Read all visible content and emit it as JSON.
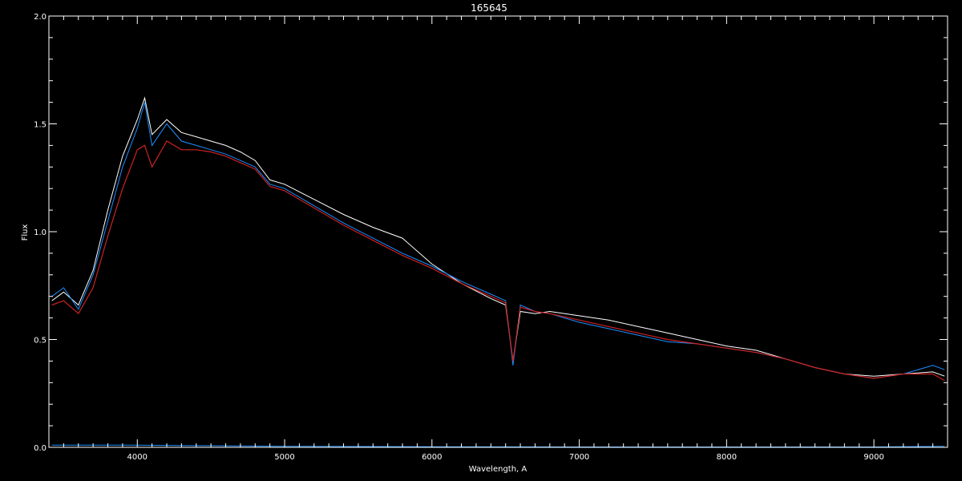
{
  "chart_data": {
    "type": "line",
    "title": "165645",
    "xlabel": "Wavelength, A",
    "ylabel": "Flux",
    "xlim": [
      3400,
      9500
    ],
    "ylim": [
      0.0,
      2.0
    ],
    "xticks": [
      4000,
      5000,
      6000,
      7000,
      8000,
      9000
    ],
    "yticks": [
      0.0,
      0.5,
      1.0,
      1.5,
      2.0
    ],
    "ytick_labels": [
      "0.0",
      "0.5",
      "1.0",
      "1.5",
      "2.0"
    ],
    "background": "#000000",
    "axis_color": "#ffffff",
    "grid": false,
    "legend": "none",
    "series": [
      {
        "color": "#ffffff",
        "x": [
          3420,
          3500,
          3600,
          3700,
          3800,
          3900,
          4000,
          4050,
          4100,
          4200,
          4300,
          4400,
          4500,
          4600,
          4700,
          4800,
          4900,
          5000,
          5200,
          5400,
          5600,
          5800,
          6000,
          6200,
          6400,
          6500,
          6550,
          6600,
          6700,
          6800,
          7000,
          7200,
          7400,
          7600,
          7800,
          8000,
          8200,
          8400,
          8600,
          8800,
          9000,
          9200,
          9400,
          9480
        ],
        "y": [
          0.68,
          0.72,
          0.66,
          0.82,
          1.1,
          1.35,
          1.52,
          1.62,
          1.45,
          1.52,
          1.46,
          1.44,
          1.42,
          1.4,
          1.37,
          1.33,
          1.24,
          1.22,
          1.15,
          1.08,
          1.02,
          0.97,
          0.85,
          0.76,
          0.69,
          0.66,
          0.4,
          0.63,
          0.62,
          0.63,
          0.61,
          0.59,
          0.56,
          0.53,
          0.5,
          0.47,
          0.45,
          0.41,
          0.37,
          0.34,
          0.33,
          0.34,
          0.35,
          0.33
        ]
      },
      {
        "color": "#1e90ff",
        "x": [
          3420,
          3500,
          3600,
          3700,
          3800,
          3900,
          4000,
          4050,
          4100,
          4200,
          4300,
          4400,
          4500,
          4600,
          4700,
          4800,
          4900,
          5000,
          5200,
          5400,
          5600,
          5800,
          6000,
          6200,
          6400,
          6500,
          6550,
          6600,
          6700,
          6800,
          7000,
          7200,
          7400,
          7600,
          7800,
          8000,
          8200,
          8400,
          8600,
          8800,
          9000,
          9200,
          9400,
          9480
        ],
        "y": [
          0.7,
          0.74,
          0.64,
          0.8,
          1.05,
          1.3,
          1.48,
          1.6,
          1.4,
          1.5,
          1.42,
          1.4,
          1.38,
          1.36,
          1.33,
          1.3,
          1.22,
          1.2,
          1.12,
          1.04,
          0.97,
          0.9,
          0.84,
          0.77,
          0.71,
          0.68,
          0.38,
          0.66,
          0.63,
          0.62,
          0.58,
          0.55,
          0.52,
          0.49,
          0.48,
          0.46,
          0.44,
          0.41,
          0.37,
          0.34,
          0.32,
          0.34,
          0.38,
          0.36
        ]
      },
      {
        "color": "#cc2222",
        "x": [
          3420,
          3500,
          3600,
          3700,
          3800,
          3900,
          4000,
          4050,
          4100,
          4200,
          4300,
          4400,
          4500,
          4600,
          4700,
          4800,
          4900,
          5000,
          5200,
          5400,
          5600,
          5800,
          6000,
          6200,
          6400,
          6500,
          6550,
          6600,
          6700,
          6800,
          7000,
          7200,
          7400,
          7600,
          7800,
          8000,
          8200,
          8400,
          8600,
          8800,
          9000,
          9200,
          9400,
          9480
        ],
        "y": [
          0.66,
          0.68,
          0.62,
          0.74,
          0.98,
          1.2,
          1.38,
          1.4,
          1.3,
          1.42,
          1.38,
          1.38,
          1.37,
          1.35,
          1.32,
          1.29,
          1.21,
          1.19,
          1.11,
          1.03,
          0.96,
          0.89,
          0.83,
          0.76,
          0.7,
          0.67,
          0.4,
          0.65,
          0.63,
          0.62,
          0.59,
          0.56,
          0.53,
          0.5,
          0.48,
          0.46,
          0.44,
          0.41,
          0.37,
          0.34,
          0.32,
          0.34,
          0.34,
          0.31
        ]
      },
      {
        "color": "#1e90ff",
        "x": [
          3420,
          4000,
          5000,
          6000,
          7000,
          8000,
          9000,
          9480
        ],
        "y": [
          0.01,
          0.01,
          0.005,
          0.003,
          0.002,
          0.002,
          0.002,
          0.005
        ]
      }
    ]
  }
}
